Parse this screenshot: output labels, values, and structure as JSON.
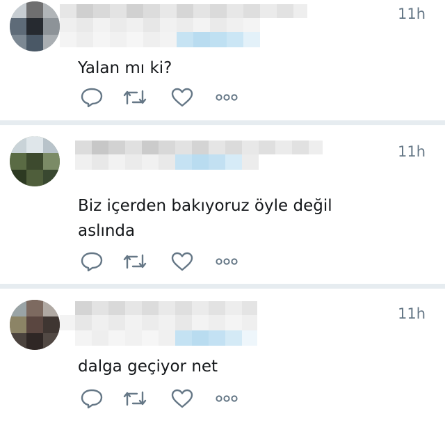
{
  "tweets": [
    {
      "time": "11h",
      "text": "Yalan mı ki?",
      "actions": [
        "reply-icon",
        "retweet-icon",
        "like-icon",
        "more-icon"
      ]
    },
    {
      "time": "11h",
      "text": "Biz içerden bakıyoruz öyle değil aslında",
      "actions": [
        "reply-icon",
        "retweet-icon",
        "like-icon",
        "more-icon"
      ]
    },
    {
      "time": "11h",
      "text": "dalga geçiyor net",
      "actions": [
        "reply-icon",
        "retweet-icon",
        "like-icon",
        "more-icon"
      ]
    }
  ],
  "colors": {
    "divider": "#e6ecf0",
    "icon": "#657786",
    "text": "#14171a",
    "mention_blur": "#b9dcf0"
  }
}
